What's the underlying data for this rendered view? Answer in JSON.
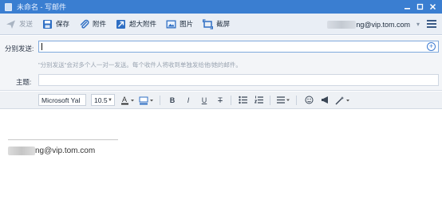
{
  "window": {
    "title": "未命名 - 写邮件",
    "controls": [
      "minimize-icon",
      "maximize-icon",
      "close-icon"
    ]
  },
  "toolbar": {
    "send_label": "发送",
    "save_label": "保存",
    "attach_label": "附件",
    "super_attach_label": "超大附件",
    "image_label": "图片",
    "screenshot_label": "截屏",
    "account_suffix": "ng@vip.tom.com"
  },
  "form": {
    "to_label": "分别发送:",
    "to_value": "",
    "hint": "\"分别发送\"会对多个人一对一发送。每个收件人将收到单独发给他/她的邮件。",
    "subject_label": "主题:",
    "subject_value": ""
  },
  "format": {
    "font_family": "Microsoft Yal",
    "font_size": "10.5",
    "bold": "B",
    "italic": "I",
    "underline": "U",
    "strike": "T"
  },
  "editor": {
    "signature_suffix": "ng@vip.tom.com"
  },
  "colors": {
    "titlebar": "#3a7ed1",
    "toolbar_bg": "#e9eef5",
    "accent": "#3d7bd2"
  }
}
